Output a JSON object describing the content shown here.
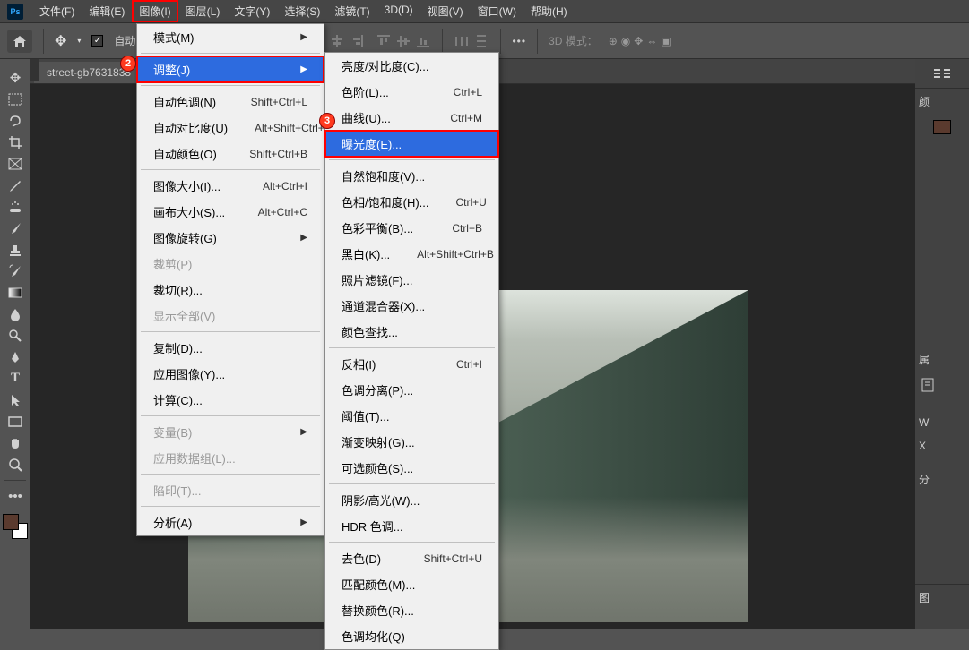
{
  "app": {
    "logo": "Ps"
  },
  "menubar": [
    {
      "label": "文件(F)"
    },
    {
      "label": "编辑(E)"
    },
    {
      "label": "图像(I)",
      "active": true
    },
    {
      "label": "图层(L)"
    },
    {
      "label": "文字(Y)"
    },
    {
      "label": "选择(S)"
    },
    {
      "label": "滤镜(T)"
    },
    {
      "label": "3D(D)"
    },
    {
      "label": "视图(V)"
    },
    {
      "label": "窗口(W)"
    },
    {
      "label": "帮助(H)"
    }
  ],
  "optionsbar": {
    "auto_label": "自动",
    "threed_mode": "3D 模式："
  },
  "doc_tab": "street-gb7631838",
  "image_menu": [
    {
      "label": "模式(M)",
      "arrow": true
    },
    {
      "sep": true
    },
    {
      "label": "调整(J)",
      "arrow": true,
      "hl": true,
      "boxed": true
    },
    {
      "sep": true
    },
    {
      "label": "自动色调(N)",
      "shortcut": "Shift+Ctrl+L"
    },
    {
      "label": "自动对比度(U)",
      "shortcut": "Alt+Shift+Ctrl+L"
    },
    {
      "label": "自动颜色(O)",
      "shortcut": "Shift+Ctrl+B"
    },
    {
      "sep": true
    },
    {
      "label": "图像大小(I)...",
      "shortcut": "Alt+Ctrl+I"
    },
    {
      "label": "画布大小(S)...",
      "shortcut": "Alt+Ctrl+C"
    },
    {
      "label": "图像旋转(G)",
      "arrow": true
    },
    {
      "label": "裁剪(P)",
      "disabled": true
    },
    {
      "label": "裁切(R)..."
    },
    {
      "label": "显示全部(V)",
      "disabled": true
    },
    {
      "sep": true
    },
    {
      "label": "复制(D)..."
    },
    {
      "label": "应用图像(Y)..."
    },
    {
      "label": "计算(C)..."
    },
    {
      "sep": true
    },
    {
      "label": "变量(B)",
      "arrow": true,
      "disabled": true
    },
    {
      "label": "应用数据组(L)...",
      "disabled": true
    },
    {
      "sep": true
    },
    {
      "label": "陷印(T)...",
      "disabled": true
    },
    {
      "sep": true
    },
    {
      "label": "分析(A)",
      "arrow": true
    }
  ],
  "adjust_menu": [
    {
      "label": "亮度/对比度(C)..."
    },
    {
      "label": "色阶(L)...",
      "shortcut": "Ctrl+L"
    },
    {
      "label": "曲线(U)...",
      "shortcut": "Ctrl+M"
    },
    {
      "label": "曝光度(E)...",
      "hl": true,
      "boxed": true
    },
    {
      "sep": true
    },
    {
      "label": "自然饱和度(V)..."
    },
    {
      "label": "色相/饱和度(H)...",
      "shortcut": "Ctrl+U"
    },
    {
      "label": "色彩平衡(B)...",
      "shortcut": "Ctrl+B"
    },
    {
      "label": "黑白(K)...",
      "shortcut": "Alt+Shift+Ctrl+B"
    },
    {
      "label": "照片滤镜(F)..."
    },
    {
      "label": "通道混合器(X)..."
    },
    {
      "label": "颜色查找..."
    },
    {
      "sep": true
    },
    {
      "label": "反相(I)",
      "shortcut": "Ctrl+I"
    },
    {
      "label": "色调分离(P)..."
    },
    {
      "label": "阈值(T)..."
    },
    {
      "label": "渐变映射(G)..."
    },
    {
      "label": "可选颜色(S)..."
    },
    {
      "sep": true
    },
    {
      "label": "阴影/高光(W)..."
    },
    {
      "label": "HDR 色调..."
    },
    {
      "sep": true
    },
    {
      "label": "去色(D)",
      "shortcut": "Shift+Ctrl+U"
    },
    {
      "label": "匹配颜色(M)..."
    },
    {
      "label": "替换颜色(R)..."
    },
    {
      "label": "色调均化(Q)"
    }
  ],
  "right_panel": {
    "tab1": "颜",
    "tab2": "属",
    "tab3": "W",
    "tab4": "X",
    "tab5": "分",
    "tab6": "图"
  },
  "badges": {
    "b2": "2",
    "b3": "3"
  }
}
